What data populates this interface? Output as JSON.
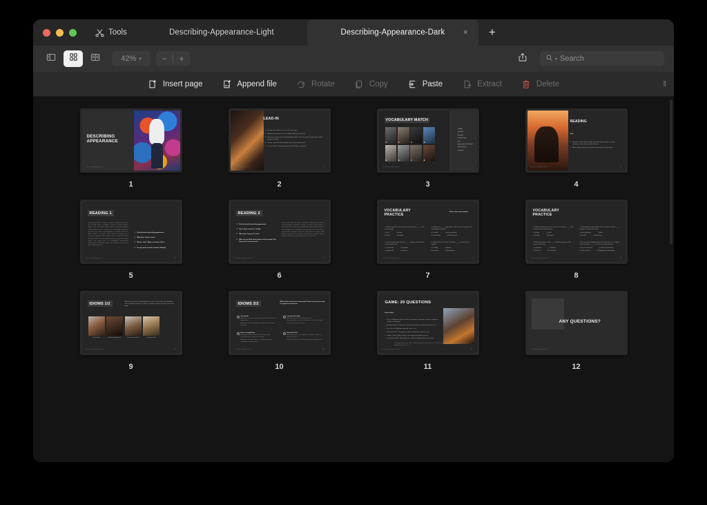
{
  "window": {
    "traffic_lights": [
      "close",
      "minimize",
      "maximize"
    ],
    "tools_label": "Tools",
    "new_tab_label": "+",
    "close_tab_label": "×"
  },
  "tabs": [
    {
      "label": "Describing-Appearance-Light",
      "active": false
    },
    {
      "label": "Describing-Appearance-Dark",
      "active": true
    }
  ],
  "toolbar": {
    "sidebar_icon": "sidebar-toggle-icon",
    "grid_icon": "grid-view-icon",
    "page_view_icon": "two-page-view-icon",
    "zoom_value": "42%",
    "zoom_caret": "▾",
    "zoom_out": "−",
    "zoom_in": "+",
    "share_icon": "share-icon",
    "search_placeholder": "Search",
    "search_value": "",
    "search_icon": "search-icon",
    "search_caret": "▾"
  },
  "pagebar": {
    "items": [
      {
        "label": "Insert page",
        "icon": "insert-page-icon",
        "enabled": true
      },
      {
        "label": "Append file",
        "icon": "append-file-icon",
        "enabled": true
      },
      {
        "label": "Rotate",
        "icon": "rotate-icon",
        "enabled": false
      },
      {
        "label": "Copy",
        "icon": "copy-icon",
        "enabled": false
      },
      {
        "label": "Paste",
        "icon": "paste-icon",
        "enabled": true
      },
      {
        "label": "Extract",
        "icon": "extract-icon",
        "enabled": false
      },
      {
        "label": "Delete",
        "icon": "trash-icon",
        "enabled": false,
        "danger": true
      }
    ],
    "grip": "‖"
  },
  "pages": [
    {
      "number": "1",
      "kind": "title",
      "title": "DESCRIBING\nAPPEARANCE",
      "footer": "Describing Appearance",
      "photo": "graffiti-wall-portrait"
    },
    {
      "number": "2",
      "kind": "lead-in",
      "title": "LEAD-IN",
      "pgno": "2",
      "footer": "Describing Appearance",
      "photo": "cafe-portrait",
      "questions": [
        "Do you have different me if on 10 years ago?",
        "What's your favorite item of clothing? Why do you like it?",
        "How much time do your spend getting ready in the mornings? Do you think it takes people too long?",
        "Do you care what other people think of your appearance?",
        "Do you think it's important to dress well? Why or why not?"
      ]
    },
    {
      "number": "3",
      "kind": "vocab-match",
      "title": "VOCABULARY MATCH",
      "pgno": "3",
      "footer": "Describing Appearance",
      "tiles": [
        "1",
        "2",
        "3",
        "4",
        "5",
        "6",
        "7",
        "8"
      ],
      "words": [
        "chubby",
        "curly hair",
        "bearded",
        "messy haired",
        "slim",
        "grey-eyed and bearded",
        "dark-skinned",
        "groomed"
      ]
    },
    {
      "number": "4",
      "kind": "reading-intro",
      "title": "READING",
      "subtitle": "Task:",
      "pgno": "4",
      "footer": "Describing Appearance",
      "photo": "friends-sunset",
      "tasks": [
        "Read the article above people will and mostly mistakes on long sentences. You have two until find you.",
        "After reading, discuss new words and answer the questions."
      ]
    },
    {
      "number": "5",
      "kind": "reading-1",
      "title": "READING 1",
      "pgno": "5",
      "footer": "Describing Appearance",
      "questions": [
        "Find all words describing appearance.",
        "What does 'charm' mean?",
        "What is 'vibe'? Make a sentence with it.",
        "Do you prefer casual or formal clothing?"
      ]
    },
    {
      "number": "6",
      "kind": "reading-2",
      "title": "READING 2",
      "pgno": "6",
      "footer": "Describing Appearance",
      "questions": [
        "Find all words describing appearance.",
        "Say it what sounds for 'buddy'.",
        "What does 'hang out' mean?",
        "What do you think about tattoos and piercings? Are they cool or unnecessary?"
      ]
    },
    {
      "number": "7",
      "kind": "vocab-practice",
      "title": "VOCABULARY\nPRACTICE",
      "instruction": "Choose the correct option.",
      "pgno": "7",
      "footer": "Describing Appearance",
      "items": [
        {
          "q": "1. You've says it's to wear baby and I know her _____ with lot of energy.",
          "a": "a) slim",
          "b": "c) plump",
          "c": "b) hairy",
          "d": "d) wrinkly"
        },
        {
          "q": "2. Despite it's _____ appearance, Tim knows he taught it fast and together and do it.",
          "a": "a) crooked",
          "b": "c) messy-minded",
          "c": "b) trustworthy",
          "d": "d) side-burned"
        },
        {
          "q": "3. Don't confident get her face _____ dialog to all and then at his uniform with",
          "a": "a) restrained",
          "b": "c) attended",
          "c": "b) pigmented",
          "d": "d) slim-cut"
        },
        {
          "q": "4. Sarah inherit in up with a fit world _____ and it been to combat.",
          "a": "a) chubby",
          "b": "c) blonde",
          "c": "b) eyebrow",
          "d": "d) dark-glance"
        }
      ]
    },
    {
      "number": "8",
      "kind": "vocab-practice-2",
      "title": "VOCABULARY\nPRACTICE",
      "pgno": "8",
      "footer": "Describing Appearance",
      "items": [
        {
          "q": "5. Jake is knows prior a I for it one, he is always _____ with matched socks and with hair.",
          "a": "a) simple",
          "b": "c) short",
          "c": "b) frumpy",
          "d": "d) elegant"
        },
        {
          "q": "7. Obst pasha a mom woman with I've been a context _____ joining it it so that she's like.",
          "a": "a) absent-blonde",
          "b": "c) bald",
          "c": "b) sand-it!",
          "d": "d) side-burnt"
        },
        {
          "q": "6. My Nanny drinks it into _____ old defines goes in she give it a new it try.",
          "a": "a) confident!",
          "b": "c) talented",
          "c": "b) thin-cut!",
          "d": "d) crisp-back"
        },
        {
          "q": "8. I'm the latest weighted looks soul while she's at a singles, who's her teeth _____ a criticize an able body set.",
          "a": "a) tiny it's the puet",
          "b": "c) almost and balance",
          "c": "b) side and own",
          "d": "d) bagging point blooming"
        }
      ]
    },
    {
      "number": "9",
      "kind": "idioms-1",
      "title": "IDIOMS 1/2",
      "instruction": "What do you think the following idioms mean? Try to guess the definition, make example sentences, and then compare with the answers on the next page.",
      "pgno": "9",
      "footer": "Describing Appearance",
      "cards": [
        {
          "photo": "street-style",
          "caption": "Turn heads?"
        },
        {
          "photo": "face-closeup",
          "caption": "Keep a straight face?"
        },
        {
          "photo": "long-hair",
          "caption": "Let your hair down?"
        },
        {
          "photo": "evening-gown",
          "caption": "Dressed to kill?"
        }
      ]
    },
    {
      "number": "10",
      "kind": "idioms-2",
      "title": "IDIOMS 2/2",
      "instruction": "Which idiom is the most surprising? Choose one and research its origin on the Internet.",
      "pgno": "10",
      "footer": "Describing Appearance",
      "entries": [
        {
          "n": "1",
          "term": "Turn heads",
          "meaning": "Meaning: to attract a lot of attention because of one's appearance.",
          "example": "Example: Her stunning dress really turned heads at the party."
        },
        {
          "n": "2",
          "term": "Let your hair down",
          "meaning": "Meaning: to relax and enjoy yourself.",
          "example": "Example: After a week of hard work, she was ready to let her hair down and relax."
        },
        {
          "n": "3",
          "term": "Keep a straight face",
          "meaning": "Meaning: to hold a serious facial expression, especially when trying not to laugh.",
          "example": "Example: It's hard to keep a straight face when watching a comedy show."
        },
        {
          "n": "4",
          "term": "Dressed to kill",
          "meaning": "Meaning: to wear very stylish or attractive clothes to impress others.",
          "example": "Example: Well, she's dressed to kill and ready to roll!"
        }
      ]
    },
    {
      "number": "11",
      "kind": "game",
      "title": "GAME: 20 QUESTIONS",
      "subtitle": "How to play:",
      "pgno": "11",
      "footer": "Describing Appearance",
      "photo": "people-talking",
      "rules": [
        "You're the Mystery Person: Pick a person but a describe a person's match an in take a could read.",
        "Ask Questions: Classmates ask yes/no questions to find out who you are.",
        "Say Yes or No: Answer only with 'yes' or 'no'.",
        "Guessing Time: They guess or after 20 questions, guess is over.",
        "Reflect: Same / discuss take a new swing and replace person.",
        "Learn New Words: Note down new words or English while each round."
      ],
      "note": "1. ('Do you have curly?' / 'No — Does this person have short hair?' / 'Yes'.)  2. ('Is this person wearing glasses?' / 'Yes — Is he/she wearing suits?' / ...)"
    },
    {
      "number": "12",
      "kind": "closing",
      "title": "ANY QUESTIONS?",
      "footer": "Describing Appearance"
    }
  ]
}
